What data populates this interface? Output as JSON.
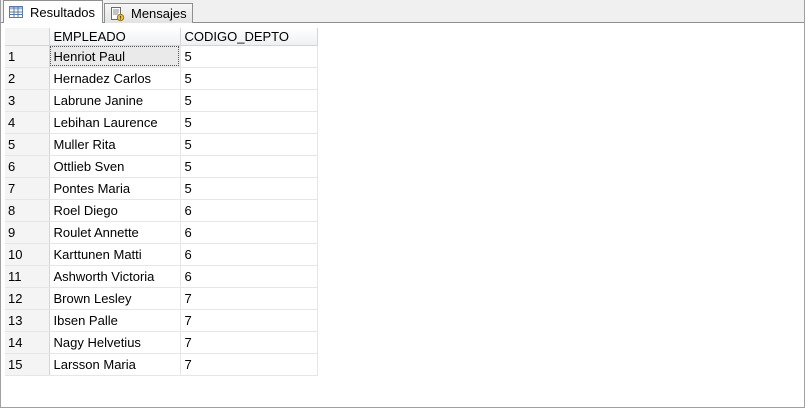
{
  "tabs": [
    {
      "label": "Resultados",
      "icon": "grid-icon",
      "active": true
    },
    {
      "label": "Mensajes",
      "icon": "messages-icon",
      "active": false
    }
  ],
  "grid": {
    "columns": [
      "EMPLEADO",
      "CODIGO_DEPTO"
    ],
    "rows": [
      {
        "n": "1",
        "empleado": "Henriot Paul",
        "depto": "5"
      },
      {
        "n": "2",
        "empleado": "Hernadez Carlos",
        "depto": "5"
      },
      {
        "n": "3",
        "empleado": "Labrune Janine",
        "depto": "5"
      },
      {
        "n": "4",
        "empleado": "Lebihan Laurence",
        "depto": "5"
      },
      {
        "n": "5",
        "empleado": "Muller Rita",
        "depto": "5"
      },
      {
        "n": "6",
        "empleado": "Ottlieb Sven",
        "depto": "5"
      },
      {
        "n": "7",
        "empleado": "Pontes Maria",
        "depto": "5"
      },
      {
        "n": "8",
        "empleado": "Roel Diego",
        "depto": "6"
      },
      {
        "n": "9",
        "empleado": "Roulet Annette",
        "depto": "6"
      },
      {
        "n": "10",
        "empleado": "Karttunen Matti",
        "depto": "6"
      },
      {
        "n": "11",
        "empleado": "Ashworth Victoria",
        "depto": "6"
      },
      {
        "n": "12",
        "empleado": "Brown Lesley",
        "depto": "7"
      },
      {
        "n": "13",
        "empleado": "Ibsen Palle",
        "depto": "7"
      },
      {
        "n": "14",
        "empleado": "Nagy Helvetius",
        "depto": "7"
      },
      {
        "n": "15",
        "empleado": "Larsson Maria",
        "depto": "7"
      }
    ],
    "selected_row": 0
  }
}
